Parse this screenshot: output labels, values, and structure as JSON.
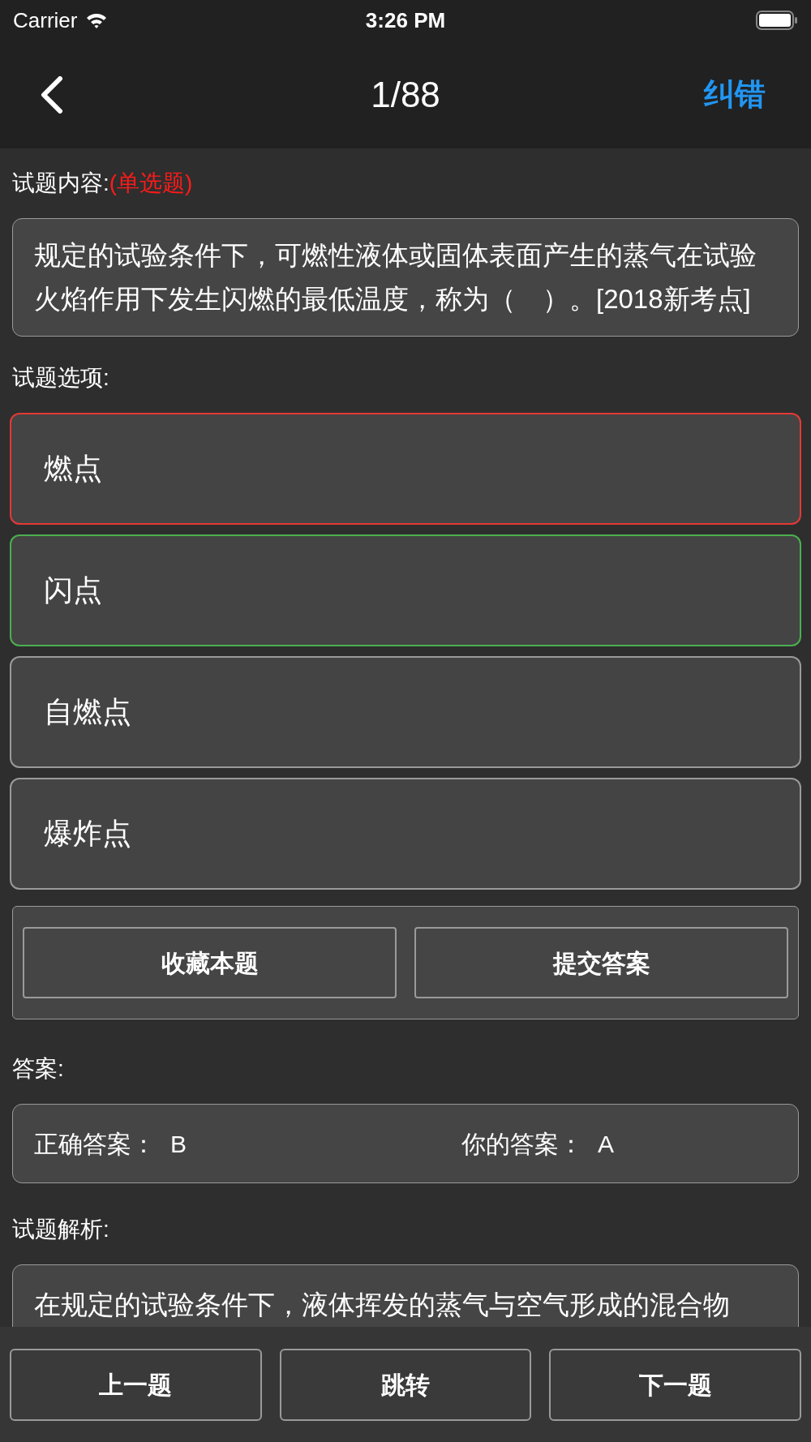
{
  "status_bar": {
    "carrier": "Carrier",
    "time": "3:26 PM"
  },
  "nav": {
    "title": "1/88",
    "action": "纠错"
  },
  "question": {
    "label": "试题内容:",
    "type": "(单选题)",
    "text": "规定的试验条件下，可燃性液体或固体表面产生的蒸气在试验火焰作用下发生闪燃的最低温度，称为（　）。[2018新考点]"
  },
  "options_label": "试题选项:",
  "options": [
    {
      "text": "燃点",
      "color": "#e53935"
    },
    {
      "text": "闪点",
      "color": "#4caf50"
    },
    {
      "text": "自燃点",
      "color": "#9a9a9a"
    },
    {
      "text": "爆炸点",
      "color": "#9a9a9a"
    }
  ],
  "actions": [
    "收藏本题",
    "提交答案"
  ],
  "answer": {
    "label": "答案:",
    "correct_label": "正确答案：",
    "correct_value": "B",
    "yours_label": "你的答案：",
    "yours_value": "A"
  },
  "analysis": {
    "label": "试题解析:",
    "text": "在规定的试验条件下，液体挥发的蒸气与空气形成的混合物"
  },
  "bottom_buttons": [
    "上一题",
    "跳转",
    "下一题"
  ]
}
